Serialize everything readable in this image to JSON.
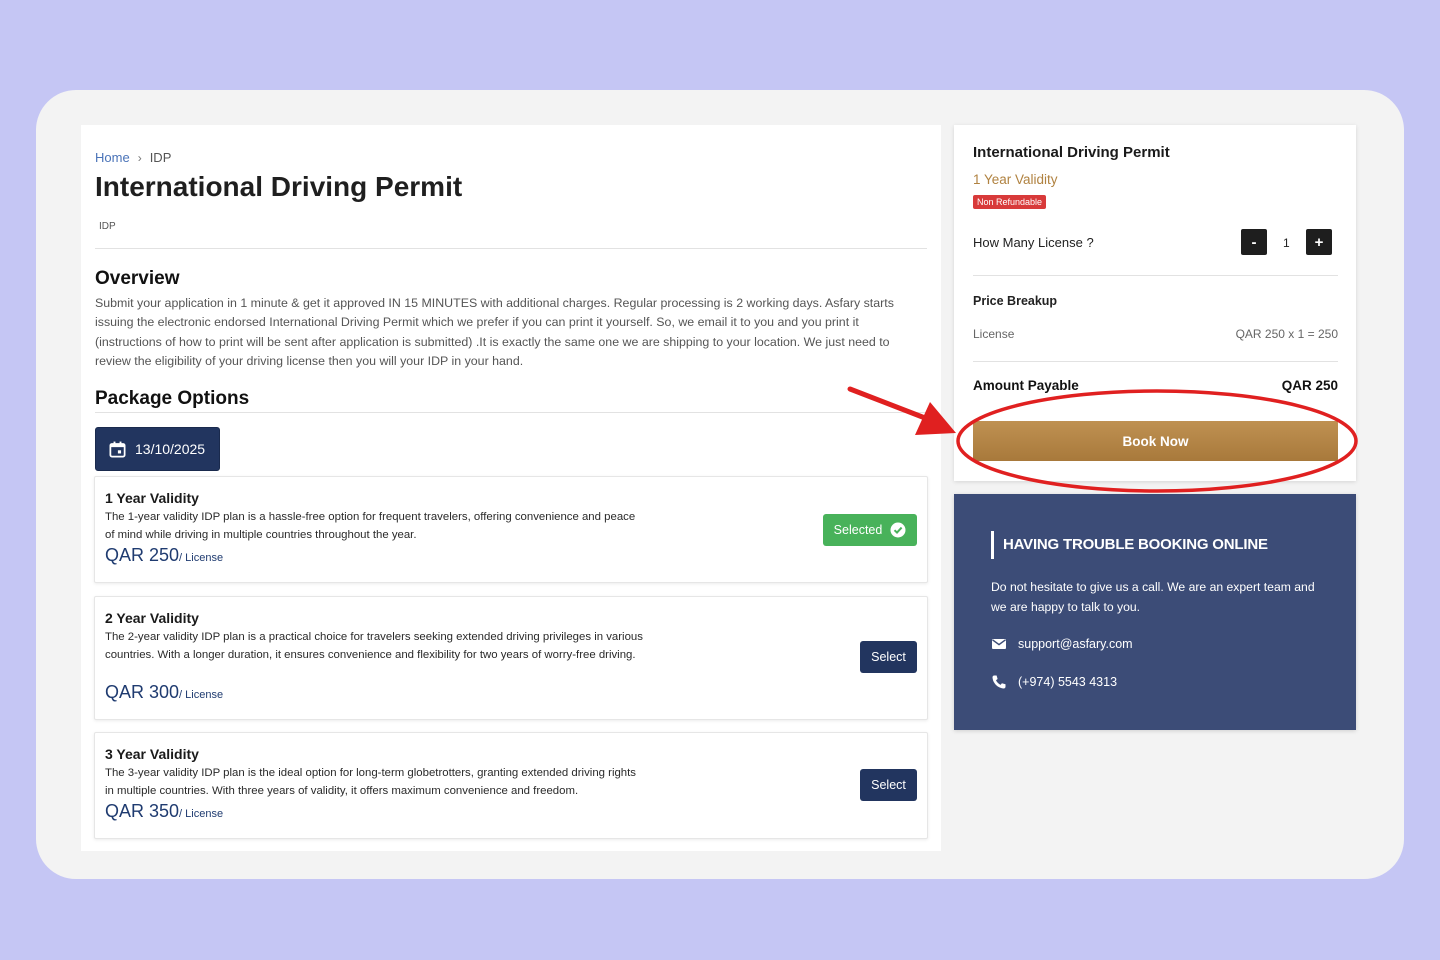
{
  "breadcrumb": {
    "home": "Home",
    "separator": "›",
    "current": "IDP"
  },
  "page": {
    "title": "International Driving Permit",
    "tag": "IDP"
  },
  "overview": {
    "heading": "Overview",
    "text": "Submit your application in 1 minute & get it approved IN 15 MINUTES with additional charges. Regular processing is 2 working days. Asfary starts issuing the electronic endorsed International Driving Permit which we prefer if you can print it yourself. So, we email it to you and you print it (instructions of how to print will be sent after application is submitted) .It is exactly the same one we are shipping to your location. We just need to review the eligibility of your driving license then you will your IDP in your hand."
  },
  "packages": {
    "heading": "Package Options",
    "date": "13/10/2025",
    "items": [
      {
        "name": "1 Year Validity",
        "desc": "The 1-year validity IDP plan is a hassle-free option for frequent travelers, offering convenience and peace of mind while driving in multiple countries throughout the year.",
        "price": "QAR 250",
        "unit": "/ License",
        "action": "Selected"
      },
      {
        "name": "2 Year Validity",
        "desc": "The 2-year validity IDP plan is a practical choice for travelers seeking extended driving privileges in various countries. With a longer duration, it ensures convenience and flexibility for two years of worry-free driving.",
        "price": "QAR 300",
        "unit": "/ License",
        "action": "Select"
      },
      {
        "name": "3 Year Validity",
        "desc": "The 3-year validity IDP plan is the ideal option for long-term globetrotters, granting extended driving rights in multiple countries. With three years of validity, it offers maximum convenience and freedom.",
        "price": "QAR 350",
        "unit": "/ License",
        "action": "Select"
      }
    ]
  },
  "summary": {
    "title": "International Driving Permit",
    "validity": "1 Year Validity",
    "badge": "Non Refundable",
    "qty_label": "How Many License ?",
    "minus": "-",
    "plus": "+",
    "qty": "1",
    "breakup_label": "Price Breakup",
    "license_label": "License",
    "license_calc": "QAR 250 x 1 = 250",
    "amount_label": "Amount Payable",
    "amount": "QAR 250",
    "book_label": "Book Now"
  },
  "help": {
    "title": "HAVING TROUBLE BOOKING ONLINE",
    "text": "Do not hesitate to give us a call. We are an expert team and we are happy to talk to you.",
    "email": "support@asfary.com",
    "phone": "(+974) 5543 4313"
  },
  "colors": {
    "page_bg": "#c5c6f4",
    "navy": "#22355f",
    "gold": "#b08240",
    "green": "#48b25a",
    "badge_red": "#d83a3a",
    "help_bg": "#3c4c77",
    "annotation_red": "#e02020"
  }
}
